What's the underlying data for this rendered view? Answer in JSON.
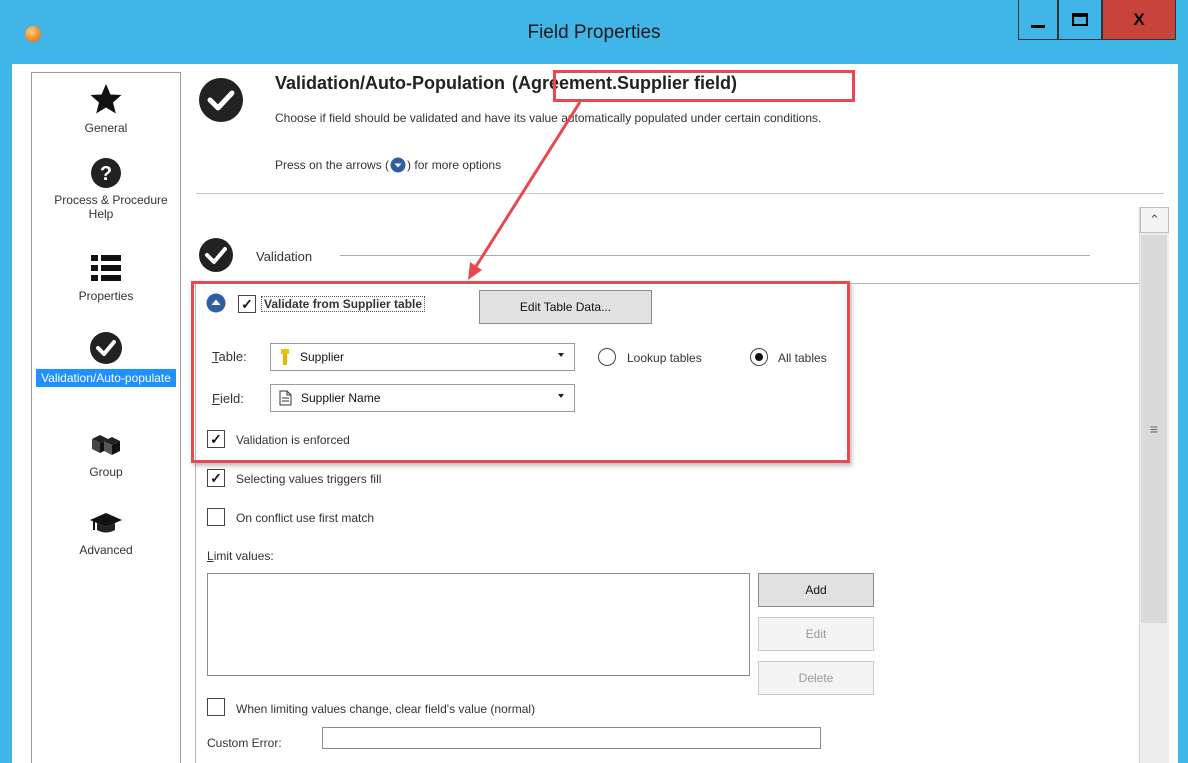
{
  "window": {
    "title": "Field Properties",
    "close_label": "X"
  },
  "sidebar": {
    "items": [
      {
        "label": "General",
        "icon": "star-icon"
      },
      {
        "label": "Process & Procedure Help",
        "icon": "question-icon"
      },
      {
        "label": "Properties",
        "icon": "list-icon"
      },
      {
        "label": "Validation/Auto-populate",
        "icon": "check-circle-icon",
        "active": true
      },
      {
        "label": "Group",
        "icon": "group-cubes-icon"
      },
      {
        "label": "Advanced",
        "icon": "graduation-cap-icon"
      }
    ]
  },
  "header": {
    "title": "Validation/Auto-Population",
    "title_suffix": "(Agreement.Supplier field)",
    "description": "Choose if field should be validated and have its value automatically populated under certain conditions.",
    "hint_before": "Press on the arrows (",
    "hint_after": ") for more options"
  },
  "validation": {
    "section_label": "Validation",
    "validate_checkbox": {
      "label": "Validate from Supplier table",
      "checked": true
    },
    "edit_table_button": "Edit Table Data...",
    "table_label_u": "T",
    "table_label_rest": "able:",
    "table_value": "Supplier",
    "field_label_u": "F",
    "field_label_rest": "ield:",
    "field_value": "Supplier Name",
    "lookup_tables_label": "Lookup tables",
    "all_tables_label": "All tables",
    "selected_radio": "All tables",
    "enforced": {
      "label": "Validation is enforced",
      "checked": true
    },
    "triggers_fill": {
      "label": "Selecting values triggers fill",
      "checked": true
    },
    "conflict_first": {
      "label": "On conflict use first match",
      "checked": false
    },
    "limit_values_u": "L",
    "limit_values_rest": "imit values:",
    "add_button": "Add",
    "edit_button": "Edit",
    "delete_button": "Delete",
    "clear_on_change": {
      "label": "When limiting values change, clear field's value (normal)",
      "checked": false
    },
    "custom_error_label": "Custom Error:",
    "custom_error_value": ""
  },
  "colors": {
    "titlebar": "#3fb5e8",
    "close": "#c7433b",
    "highlight": "#e8484f",
    "selected": "#1e90ff"
  }
}
